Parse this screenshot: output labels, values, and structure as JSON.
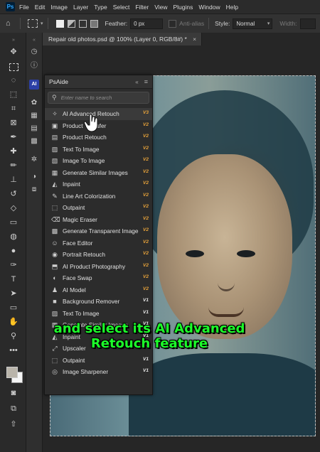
{
  "app": {
    "logo": "Ps",
    "menu": [
      "File",
      "Edit",
      "Image",
      "Layer",
      "Type",
      "Select",
      "Filter",
      "View",
      "Plugins",
      "Window",
      "Help"
    ]
  },
  "options_bar": {
    "feather_label": "Feather:",
    "feather_value": "0 px",
    "antialias_label": "Anti-alias",
    "style_label": "Style:",
    "style_value": "Normal",
    "width_label": "Width:"
  },
  "document": {
    "tab_title": "Repair old photos.psd @ 100% (Layer 0, RGB/8#) *",
    "close": "×"
  },
  "plugin_panel": {
    "title": "PsAide",
    "collapse": "«",
    "menu": "≡",
    "search_placeholder": "Enter name to search",
    "items": [
      {
        "label": "AI Advanced Retouch",
        "version": "V3",
        "icon": "✧"
      },
      {
        "label": "Product Transfer",
        "version": "V2",
        "icon": "▣"
      },
      {
        "label": "Product Retouch",
        "version": "V2",
        "icon": "▤"
      },
      {
        "label": "Text To Image",
        "version": "V2",
        "icon": "▨"
      },
      {
        "label": "Image To Image",
        "version": "V2",
        "icon": "▧"
      },
      {
        "label": "Generate Similar Images",
        "version": "V2",
        "icon": "▦"
      },
      {
        "label": "Inpaint",
        "version": "V2",
        "icon": "◭"
      },
      {
        "label": "Line Art Colorization",
        "version": "V2",
        "icon": "✎"
      },
      {
        "label": "Outpaint",
        "version": "V2",
        "icon": "⬚"
      },
      {
        "label": "Magic Eraser",
        "version": "V2",
        "icon": "⌫"
      },
      {
        "label": "Generate Transparent Image",
        "version": "V2",
        "icon": "▩"
      },
      {
        "label": "Face Editor",
        "version": "V2",
        "icon": "☺"
      },
      {
        "label": "Portrait Retouch",
        "version": "V2",
        "icon": "◉"
      },
      {
        "label": "AI Product Photography",
        "version": "V2",
        "icon": "⬒"
      },
      {
        "label": "Face Swap",
        "version": "V2",
        "icon": "◐"
      },
      {
        "label": "AI Model",
        "version": "V2",
        "icon": "♟"
      },
      {
        "label": "Background Remover",
        "version": "V1",
        "icon": "■"
      },
      {
        "label": "Text To Image",
        "version": "V1",
        "icon": "▨"
      },
      {
        "label": "Generate Similar Images",
        "version": "V1",
        "icon": "▦"
      },
      {
        "label": "Inpaint",
        "version": "V1",
        "icon": "◭"
      },
      {
        "label": "Upscaler",
        "version": "V1",
        "icon": "⤢"
      },
      {
        "label": "Outpaint",
        "version": "V1",
        "icon": "⬚"
      },
      {
        "label": "Image Sharpener",
        "version": "V1",
        "icon": "◎"
      }
    ]
  },
  "caption": {
    "line1": "and select its AI Advanced",
    "line2": "Retouch feature"
  },
  "colors": {
    "caption_green": "#1cff2a",
    "version_v2": "#e8a33a",
    "ps_blue": "#31a8ff"
  }
}
